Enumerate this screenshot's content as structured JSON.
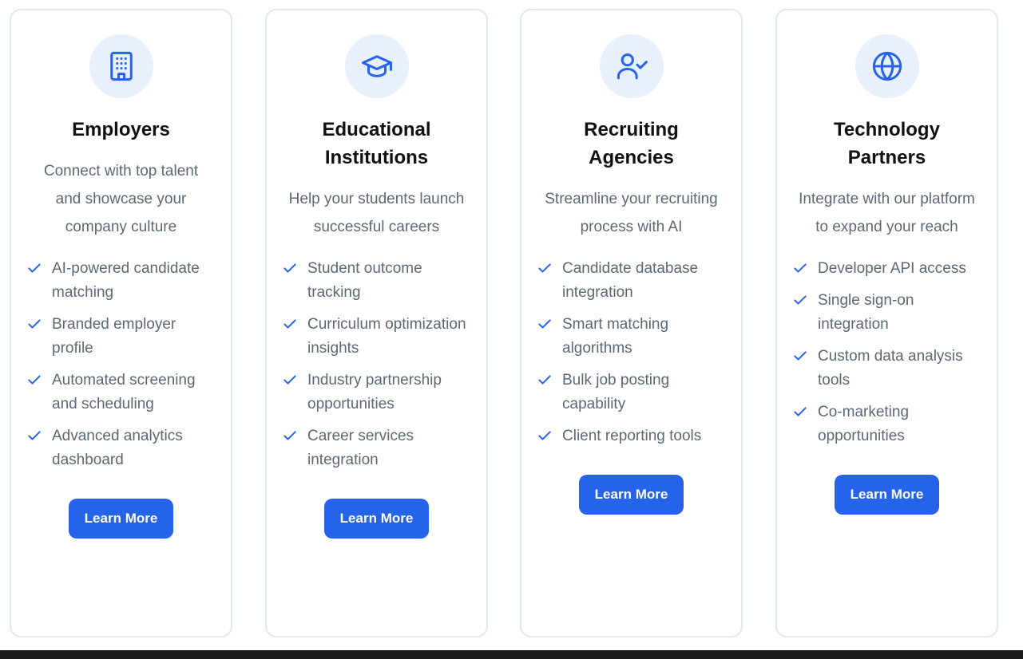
{
  "colors": {
    "accent": "#2563eb",
    "icon_bg": "#e8effd",
    "title": "#0f1115",
    "body_text": "#5d6876",
    "card_border": "#e3e7ee"
  },
  "cards": [
    {
      "icon": "building-icon",
      "title": "Employers",
      "description": "Connect with top talent and showcase your company culture",
      "features": [
        "AI-powered candidate matching",
        "Branded employer profile",
        "Automated screening and scheduling",
        "Advanced analytics dashboard"
      ],
      "button_label": "Learn More"
    },
    {
      "icon": "graduation-cap-icon",
      "title": "Educational Institutions",
      "description": "Help your students launch successful careers",
      "features": [
        "Student outcome tracking",
        "Curriculum optimization insights",
        "Industry partnership opportunities",
        "Career services integration"
      ],
      "button_label": "Learn More"
    },
    {
      "icon": "user-check-icon",
      "title": "Recruiting Agencies",
      "description": "Streamline your recruiting process with AI",
      "features": [
        "Candidate database integration",
        "Smart matching algorithms",
        "Bulk job posting capability",
        "Client reporting tools"
      ],
      "button_label": "Learn More"
    },
    {
      "icon": "globe-icon",
      "title": "Technology Partners",
      "description": "Integrate with our platform to expand your reach",
      "features": [
        "Developer API access",
        "Single sign-on integration",
        "Custom data analysis tools",
        "Co-marketing opportunities"
      ],
      "button_label": "Learn More"
    }
  ]
}
